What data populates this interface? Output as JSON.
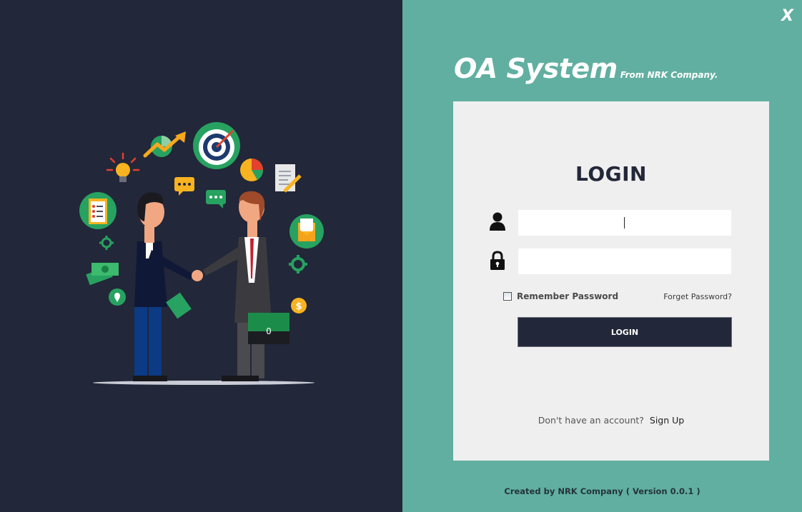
{
  "window": {
    "close_label": "X"
  },
  "brand": {
    "title": "OA System",
    "subtitle": "From NRK Company."
  },
  "login": {
    "heading": "LOGIN",
    "username": {
      "value": "",
      "placeholder": "",
      "icon": "user-icon"
    },
    "password": {
      "value": "",
      "placeholder": "",
      "icon": "lock-icon"
    },
    "remember_label": "Remember Password",
    "remember_checked": false,
    "forget_label": "Forget Password?",
    "button_label": "LOGIN",
    "signup_prompt": "Don't have an account?",
    "signup_label": "Sign Up"
  },
  "footer": {
    "text": "Created by NRK Company ( Version 0.0.1 )"
  },
  "illustration": {
    "briefcase_label": "0"
  },
  "colors": {
    "left_bg": "#222739",
    "right_bg": "#61afa0",
    "card_bg": "#efefef",
    "button_bg": "#222739"
  }
}
